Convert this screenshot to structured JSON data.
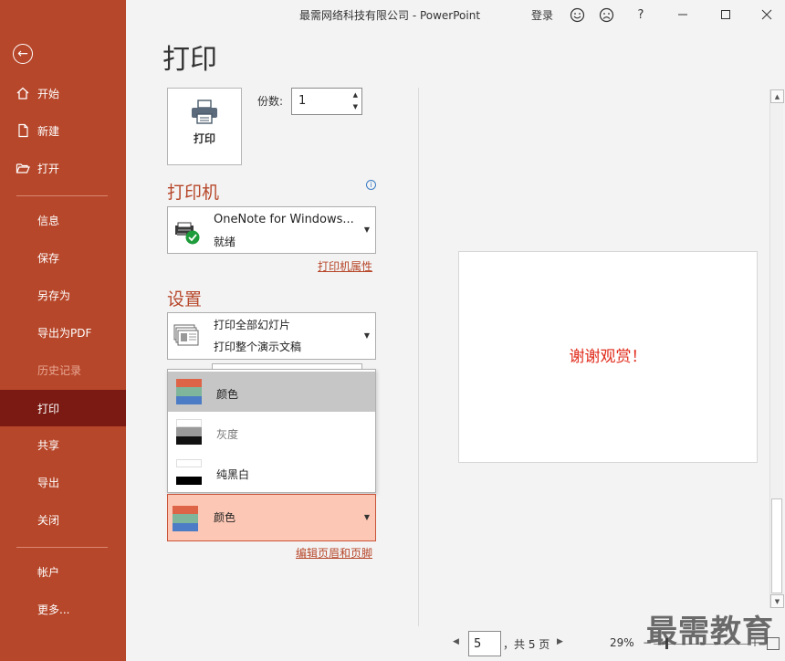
{
  "window": {
    "title": "最需网络科技有限公司  -  PowerPoint",
    "login": "登录",
    "help": "?"
  },
  "sidebar": {
    "items": [
      {
        "label": "开始"
      },
      {
        "label": "新建"
      },
      {
        "label": "打开"
      },
      {
        "label": "信息"
      },
      {
        "label": "保存"
      },
      {
        "label": "另存为"
      },
      {
        "label": "导出为PDF"
      },
      {
        "label": "历史记录"
      },
      {
        "label": "打印"
      },
      {
        "label": "共享"
      },
      {
        "label": "导出"
      },
      {
        "label": "关闭"
      },
      {
        "label": "帐户"
      },
      {
        "label": "更多..."
      }
    ],
    "active": "打印",
    "disabled": "历史记录"
  },
  "main": {
    "title": "打印",
    "print_button": "打印",
    "copies_label": "份数:",
    "copies_value": "1",
    "printer_heading": "打印机",
    "printer": {
      "name": "OneNote for Windows...",
      "status": "就绪"
    },
    "printer_properties": "打印机属性",
    "settings_heading": "设置",
    "slides_setting": {
      "line1": "打印全部幻灯片",
      "line2": "打印整个演示文稿"
    },
    "color_options": [
      {
        "label": "颜色",
        "selected": true
      },
      {
        "label": "灰度",
        "selected": false
      },
      {
        "label": "纯黑白",
        "selected": false
      }
    ],
    "color_selected": "颜色",
    "edit_header_footer": "编辑页眉和页脚"
  },
  "preview": {
    "slide_text": "谢谢观赏！",
    "page_current": "5",
    "page_total": "，共 5 页",
    "zoom": "29%",
    "zoom_minus": "−",
    "zoom_plus": "+"
  },
  "watermark": "最需教育",
  "colors": {
    "accent": "#b7472a",
    "active_nav": "#7a1a12",
    "selected_bg": "#fcc7b4",
    "slide_text": "#e02a1a"
  },
  "icons": [
    "back-arrow-icon",
    "home-icon",
    "new-file-icon",
    "folder-open-icon",
    "smile-icon",
    "frown-icon",
    "minimize-icon",
    "maximize-icon",
    "close-icon",
    "printer-icon",
    "info-icon",
    "chevron-down-icon"
  ]
}
